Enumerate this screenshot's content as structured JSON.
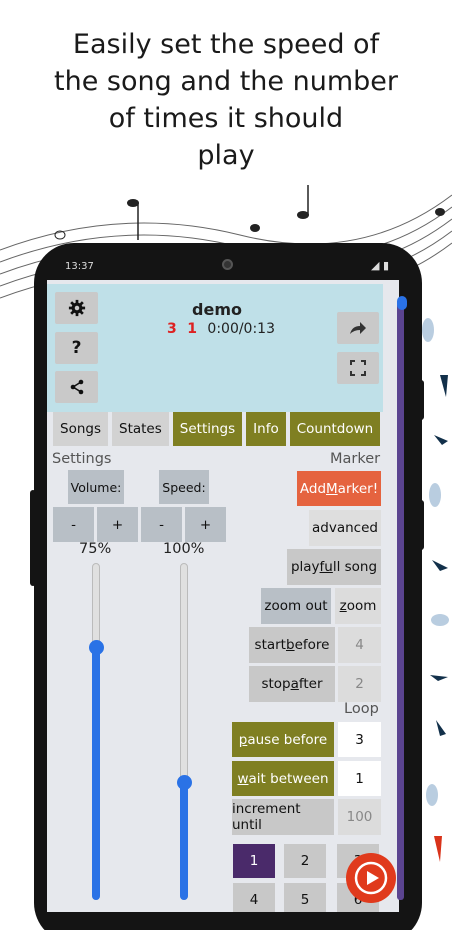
{
  "promo": {
    "line1": "Easily set the speed of",
    "line2": "the song and the number",
    "line3": "of times it should",
    "line4": "play"
  },
  "status_bar": {
    "time": "13:37"
  },
  "header": {
    "song_title": "demo",
    "count_a": "3",
    "count_b": "1",
    "time_position": "0:00/0:13"
  },
  "tabs": [
    {
      "label": "Songs",
      "active": false
    },
    {
      "label": "States",
      "active": false
    },
    {
      "label": "Settings",
      "active": true
    },
    {
      "label": "Info",
      "active": true
    },
    {
      "label": "Countdown",
      "active": true
    }
  ],
  "settings": {
    "section_label": "Settings",
    "volume_label": "Volume:",
    "speed_label": "Speed:",
    "minus": "-",
    "plus": "+",
    "volume_value": "75%",
    "speed_value": "100%",
    "volume_level": 0.75,
    "speed_level": 0.35
  },
  "marker": {
    "section_label": "Marker",
    "add_marker_pre": "Add ",
    "add_marker_u": "M",
    "add_marker_post": "arker!",
    "advanced": "advanced",
    "play_full_pre": "play ",
    "play_full_u": "fu",
    "play_full_post": "ll song",
    "zoom_out": "zoom out",
    "zoom_u": "z",
    "zoom_post": "oom",
    "start_before_pre": "start ",
    "start_before_u": "b",
    "start_before_post": "efore",
    "start_before_value": "4",
    "stop_after_pre": "stop ",
    "stop_after_u": "a",
    "stop_after_post": "fter",
    "stop_after_value": "2"
  },
  "loop": {
    "section_label": "Loop",
    "pause_before_u": "p",
    "pause_before_post": "ause before",
    "pause_before_value": "3",
    "wait_between_u": "w",
    "wait_between_post": "ait between",
    "wait_between_value": "1",
    "increment_until": "increment until",
    "increment_until_value": "100",
    "numbers": [
      "1",
      "2",
      "3",
      "4",
      "5",
      "6"
    ]
  },
  "colors": {
    "accent_olive": "#7f7f22",
    "header_bg": "#bfe0e8",
    "add_marker": "#e5633f",
    "selected_number": "#4a2a6a",
    "slider": "#2a72e6",
    "play_fab": "#e03a1c"
  }
}
